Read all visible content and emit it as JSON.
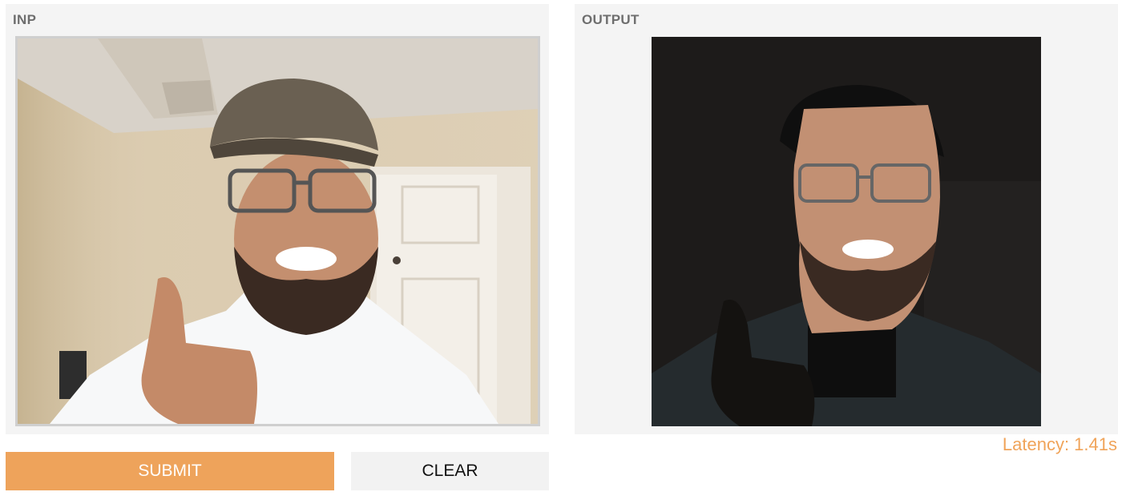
{
  "input": {
    "label": "INP"
  },
  "output": {
    "label": "OUTPUT"
  },
  "latency": "Latency: 1.41s",
  "buttons": {
    "submit": "SUBMIT",
    "clear": "CLEAR"
  },
  "colors": {
    "accent": "#eea35b",
    "latency_text": "#f0a45a",
    "panel_bg": "#f4f4f4"
  }
}
